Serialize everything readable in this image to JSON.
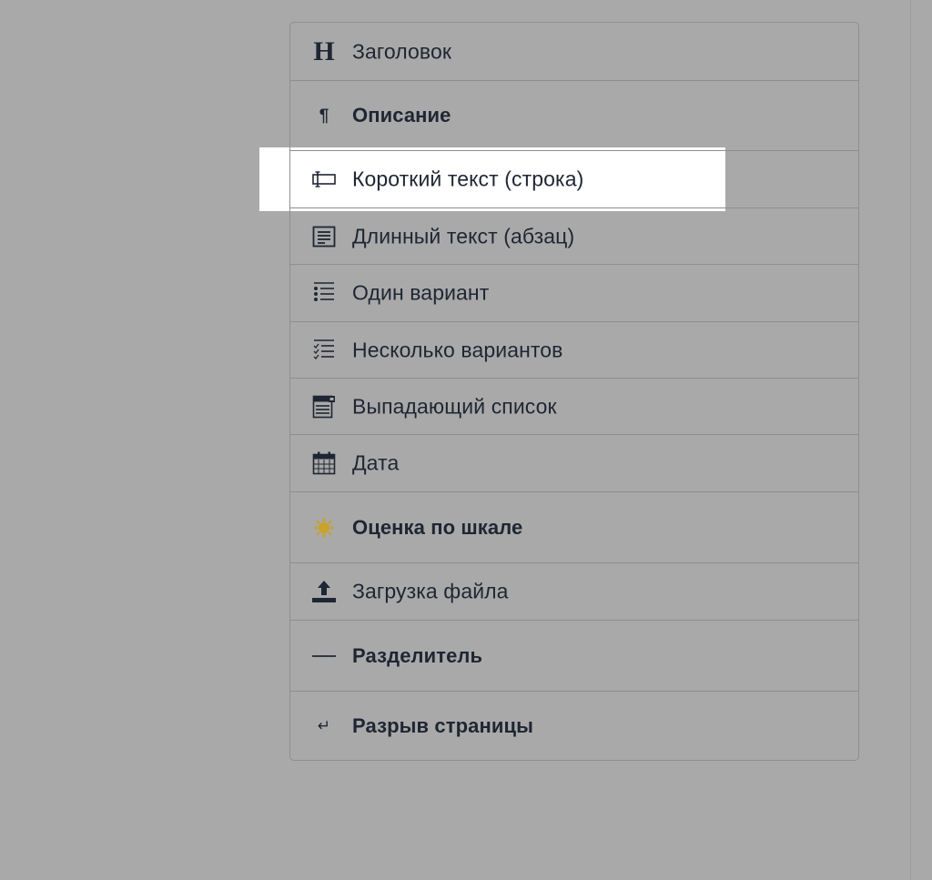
{
  "menu": {
    "items": [
      {
        "label": "Заголовок",
        "icon": "heading-icon"
      },
      {
        "label": "Описание",
        "icon": "paragraph-icon"
      },
      {
        "label": "Короткий текст (строка)",
        "icon": "text-input-icon"
      },
      {
        "label": "Длинный текст (абзац)",
        "icon": "textarea-icon"
      },
      {
        "label": "Один вариант",
        "icon": "radio-list-icon"
      },
      {
        "label": "Несколько вариантов",
        "icon": "checkbox-list-icon"
      },
      {
        "label": "Выпадающий список",
        "icon": "dropdown-icon"
      },
      {
        "label": "Дата",
        "icon": "calendar-icon"
      },
      {
        "label": "Оценка по шкале",
        "icon": "rating-sun-icon"
      },
      {
        "label": "Загрузка файла",
        "icon": "upload-icon"
      },
      {
        "label": "Разделитель",
        "icon": "divider-line-icon"
      },
      {
        "label": "Разрыв страницы",
        "icon": "page-break-icon"
      }
    ]
  },
  "colors": {
    "background": "#a9a9a9",
    "highlight": "#ffffff",
    "text": "#1f2633",
    "accent_sun": "#c9a227"
  }
}
